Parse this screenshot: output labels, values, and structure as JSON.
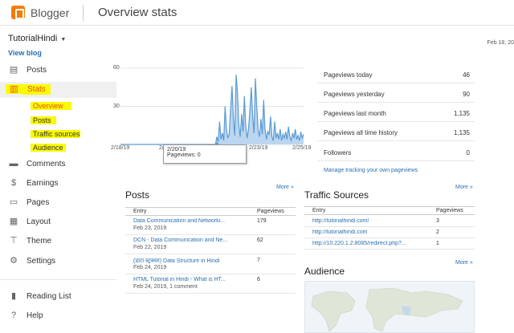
{
  "app": {
    "brand": "Blogger",
    "page_title": "Overview stats"
  },
  "blog": {
    "name": "TutorialHindi",
    "view_blog": "View blog"
  },
  "date": "Feb 18, 20",
  "sidebar": {
    "items": [
      {
        "label": "Posts",
        "icon": "posts-icon"
      },
      {
        "label": "Stats",
        "icon": "stats-icon"
      },
      {
        "label": "Comments",
        "icon": "comments-icon"
      },
      {
        "label": "Earnings",
        "icon": "earnings-icon"
      },
      {
        "label": "Pages",
        "icon": "pages-icon"
      },
      {
        "label": "Layout",
        "icon": "layout-icon"
      },
      {
        "label": "Theme",
        "icon": "theme-icon"
      },
      {
        "label": "Settings",
        "icon": "settings-icon"
      },
      {
        "label": "Reading List",
        "icon": "reading-list-icon"
      },
      {
        "label": "Help",
        "icon": "help-icon"
      }
    ],
    "stats_sub": [
      "Overview",
      "Posts",
      "Traffic sources",
      "Audience"
    ]
  },
  "chart_data": {
    "type": "area",
    "yticks": [
      "60",
      "30"
    ],
    "xticks": [
      "2/18/19",
      "2/",
      "2/23/19",
      "2/25/19"
    ],
    "ylim": [
      0,
      60
    ],
    "values": [
      0,
      0,
      0,
      0,
      0,
      0,
      0,
      0,
      0,
      0,
      0,
      0,
      0,
      0,
      0,
      0,
      0,
      0,
      0,
      0,
      0,
      0,
      0,
      0,
      0,
      0,
      0,
      0,
      0,
      0,
      0,
      0,
      0,
      0,
      0,
      0,
      0,
      0,
      0,
      0,
      0,
      0,
      0,
      0,
      0,
      0,
      0,
      0,
      0,
      0,
      0,
      0,
      0,
      0,
      0,
      0,
      0,
      0,
      0,
      0,
      0,
      0,
      0,
      0,
      0,
      0,
      0,
      0,
      0,
      0,
      6,
      2,
      18,
      4,
      9,
      3,
      30,
      12,
      5,
      8,
      28,
      46,
      20,
      7,
      55,
      40,
      15,
      6,
      24,
      10,
      38,
      14,
      5,
      12,
      26,
      45,
      22,
      9,
      52,
      30,
      11,
      6,
      20,
      8,
      35,
      12,
      4,
      10,
      8,
      22,
      6,
      3,
      18,
      5,
      9,
      4,
      12,
      3,
      8,
      5,
      10,
      4,
      14,
      6,
      3,
      9,
      5,
      12,
      4,
      7,
      3,
      10,
      5,
      8
    ],
    "color": "#5b9bd5"
  },
  "tooltip": {
    "date": "2/20/19",
    "value": "Pageviews: 0"
  },
  "stats": [
    {
      "label": "Pageviews today",
      "value": "46"
    },
    {
      "label": "Pageviews yesterday",
      "value": "90"
    },
    {
      "label": "Pageviews last month",
      "value": "1,135"
    },
    {
      "label": "Pageviews all time history",
      "value": "1,135"
    },
    {
      "label": "Followers",
      "value": "0"
    }
  ],
  "manage_link": "Manage tracking your own pageviews",
  "more": "More »",
  "posts": {
    "title": "Posts",
    "col_entry": "Entry",
    "col_views": "Pageviews",
    "rows": [
      {
        "title": "Data Communication and Networki...",
        "date": "Feb 23, 2019",
        "views": "179"
      },
      {
        "title": "DCN - Data Communication and Ne...",
        "date": "Feb 22, 2019",
        "views": "62"
      },
      {
        "title": "(डाटा स्ट्रक्चर) Data Structure in Hindi",
        "date": "Feb 24, 2019",
        "views": "7"
      },
      {
        "title": "HTML Tutorial in Hindi - What is HT...",
        "date": "Feb 24, 2019, 1 comment",
        "views": "6"
      }
    ]
  },
  "traffic": {
    "title": "Traffic Sources",
    "col_entry": "Entry",
    "col_views": "Pageviews",
    "rows": [
      {
        "url": "http://tutorialhindi.com/",
        "views": "3"
      },
      {
        "url": "http://tutorialhindi.com",
        "views": "2"
      },
      {
        "url": "http://10.220.1.2:8085/redirect.php?...",
        "views": "1"
      }
    ]
  },
  "audience": {
    "title": "Audience"
  }
}
